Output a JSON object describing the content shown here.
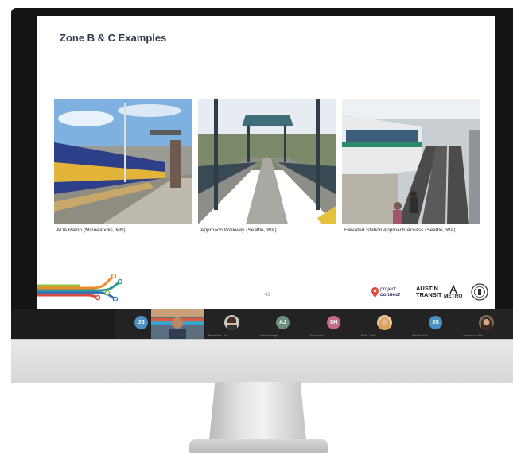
{
  "slide": {
    "title": "Zone B & C Examples",
    "photos": [
      {
        "caption": "ADA Ramp (Minneapolis, MN)"
      },
      {
        "caption": "Approach Walkway (Seattle, WA)"
      },
      {
        "caption": "Elevated Station Approach/Access (Seattle, WA)"
      }
    ],
    "page_number": "43",
    "logos": {
      "project_connect": [
        "project",
        "connect"
      ],
      "austin_transit": [
        "AUSTIN",
        "TRANSIT"
      ],
      "metro": "METRO"
    }
  },
  "participants": [
    {
      "initials": "JS",
      "name": "",
      "color": "#4a90c2"
    },
    {
      "initials": "",
      "name": "",
      "color": ""
    },
    {
      "initials": "",
      "name": "Bernardez, Lia",
      "color": ""
    },
    {
      "initials": "AJ",
      "name": "Jackson, Angel",
      "color": "#6b8f7a"
    },
    {
      "initials": "SH",
      "name": "Sara Hugo",
      "color": "#c46a8a"
    },
    {
      "initials": "",
      "name": "Ross, Jamil",
      "color": ""
    },
    {
      "initials": "JS",
      "name": "Santini, Julia",
      "color": "#4a90c2"
    },
    {
      "initials": "",
      "name": "Thompson, Mila",
      "color": ""
    }
  ],
  "colors": {
    "title": "#2e3a4b",
    "line_orange": "#f08a24",
    "line_teal": "#2f9a93",
    "line_blue": "#3c6fb5",
    "line_red": "#d84a3a",
    "line_lime": "#8cc63f"
  }
}
